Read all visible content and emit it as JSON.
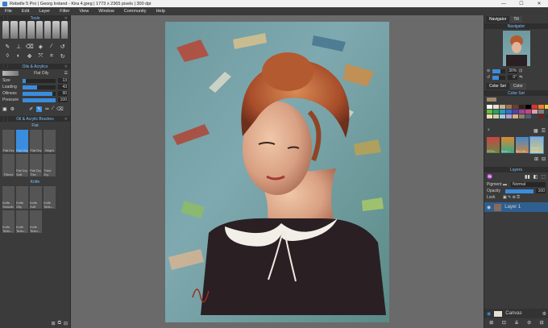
{
  "window": {
    "title": "Rebelle 5 Pro | Georg Ireland - Kira 4.jpeg | 1773 x 2365 pixels | 300 dpi",
    "minimize": "—",
    "maximize": "☐",
    "close": "✕"
  },
  "menu": [
    "File",
    "Edit",
    "Layer",
    "Filter",
    "View",
    "Window",
    "Community",
    "Help"
  ],
  "tools": {
    "title": "Tools"
  },
  "oils": {
    "title": "Oils & Acrylics",
    "brush_name": "Flat Oily",
    "size_label": "Size",
    "size_value": "13",
    "size_pct": 0.1,
    "loading_label": "Loading",
    "loading_value": "43",
    "loading_pct": 0.43,
    "oiliness_label": "Oiliness",
    "oiliness_value": "90",
    "oiliness_pct": 0.9,
    "pressure_label": "Pressure",
    "pressure_value": "100",
    "pressure_pct": 1.0
  },
  "brushes": {
    "title": "Oil & Acrylic Brushes",
    "group_flat": "Flat",
    "flat_items": [
      "Flat Dry",
      "Flat Oily",
      "Flat Dry",
      "Bright",
      "Filbert",
      "Flat Dry Soft",
      "Flat Dry Thin",
      "Thick Dry"
    ],
    "group_knife": "Knife",
    "knife_items": [
      "Knife Smooth",
      "Knife Oily",
      "Knife Soft",
      "Knife Textu...",
      "Knife Textu...",
      "Knife Textu...",
      "Knife Textu..."
    ]
  },
  "navigator": {
    "tab1": "Navigator",
    "tab2": "Tilt",
    "title": "Navigator",
    "zoom": "30%",
    "angle": "0°"
  },
  "colorset": {
    "tab1": "Color Set",
    "tab2": "Color",
    "title": "Color Set",
    "swatches": [
      "#ffffff",
      "#e8e0d0",
      "#c8b090",
      "#a07050",
      "#6a4030",
      "#3a2018",
      "#000000",
      "#e03030",
      "#f08030",
      "#f0d030",
      "#60c040",
      "#30a060",
      "#20a0c0",
      "#3070d0",
      "#5040b0",
      "#a040a0",
      "#d04080",
      "#e0a0a0",
      "#808080",
      "#404040",
      "#f0e0b0",
      "#c0d8a0",
      "#a0c8e0",
      "#b0a0d0",
      "#d0b090",
      "#908060",
      "#506070",
      "#304050",
      "#702020",
      "#204030"
    ]
  },
  "palette": {
    "items": [
      "SPEN...",
      "Birds 1",
      "Bird Wa...",
      "Default Scene"
    ]
  },
  "layers": {
    "title": "Layers",
    "pigment_label": "Pigment",
    "blend": "Normal",
    "opacity_label": "Opacity",
    "opacity_value": "100",
    "lock_label": "Lock",
    "layer1": "Layer 1",
    "canvas": "Canvas"
  },
  "painting": {
    "signature": "Ireland 2020"
  }
}
